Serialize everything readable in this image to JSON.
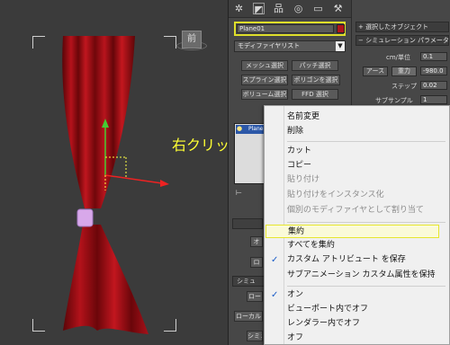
{
  "viewport": {
    "viewcube_label": "前",
    "annotation": "右クリック"
  },
  "command_panel": {
    "tab_icons": [
      "display-sun",
      "modify",
      "hierarchy",
      "motion",
      "display",
      "utilities"
    ],
    "object_name": "Plane01",
    "object_color": "#b0141b",
    "modifier_list": "モディファイヤリスト",
    "buttons": [
      "メッシュ選択",
      "パッチ選択",
      "スプライン選択",
      "ポリゴンを選択",
      "ボリューム選択",
      "FFD 選択"
    ],
    "stack_label": "Plane",
    "rollout_labels": [
      "シミュ",
      "ロー",
      "ローカル",
      "シミュ"
    ],
    "side_buttons": [
      "オ",
      "ロ"
    ]
  },
  "params_panel": {
    "selected_object_title": "選択したオブジェクト",
    "sim_params_title": "シミュレーション パラメータ",
    "cm_per_unit_label": "cm/単位",
    "cm_per_unit_value": "0.1",
    "earth_button": "アース",
    "gravity_button": "重力",
    "gravity_value": "-980.0",
    "step_label": "ステップ",
    "step_value": "0.02",
    "subsample_label": "サブサンプル",
    "subsample_value": "1"
  },
  "context_menu": {
    "group1": [
      {
        "label": "名前変更",
        "disabled": false,
        "checked": false
      },
      {
        "label": "削除",
        "disabled": false,
        "checked": false
      }
    ],
    "group2": [
      {
        "label": "カット",
        "disabled": false,
        "checked": false
      },
      {
        "label": "コピー",
        "disabled": false,
        "checked": false
      },
      {
        "label": "貼り付け",
        "disabled": true,
        "checked": false
      },
      {
        "label": "貼り付けをインスタンス化",
        "disabled": true,
        "checked": false
      },
      {
        "label": "個別のモディファイヤとして割り当て",
        "disabled": true,
        "checked": false
      }
    ],
    "group3": [
      {
        "label": "集約",
        "disabled": false,
        "checked": false,
        "highlight": true
      },
      {
        "label": "すべてを集約",
        "disabled": false,
        "checked": false
      },
      {
        "label": "カスタム アトリビュート を保存",
        "disabled": false,
        "checked": true
      },
      {
        "label": "サブアニメーション カスタム属性を保持",
        "disabled": false,
        "checked": false
      }
    ],
    "group4": [
      {
        "label": "オン",
        "disabled": false,
        "checked": true
      },
      {
        "label": "ビューポート内でオフ",
        "disabled": false,
        "checked": false
      },
      {
        "label": "レンダラー内でオフ",
        "disabled": false,
        "checked": false
      },
      {
        "label": "オフ",
        "disabled": false,
        "checked": false
      }
    ],
    "check_glyph": "✓"
  }
}
